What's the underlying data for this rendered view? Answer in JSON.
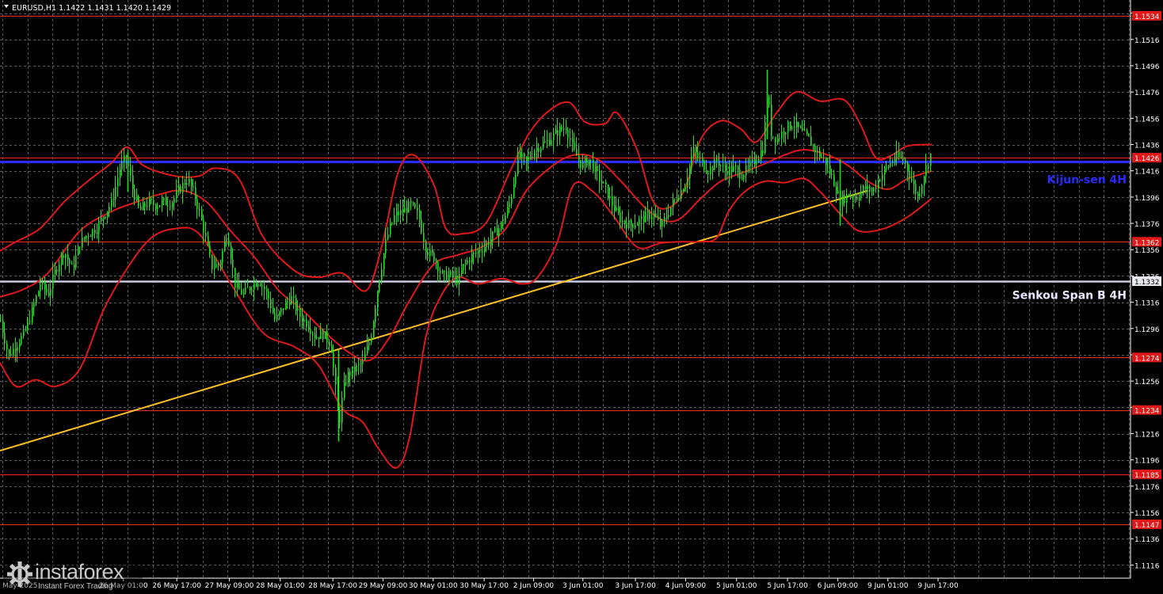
{
  "header": {
    "menu_arrow": "triangle-down-icon",
    "title": "EURUSD,H1  1.1422 1.1431 1.1420 1.1429"
  },
  "logo": {
    "name": "instaforex",
    "tagline": "Instant Forex Trading",
    "icon": "gear-icon"
  },
  "chart_data": {
    "type": "candlestick",
    "symbol": "EURUSD",
    "timeframe": "H1",
    "last_bar": {
      "open": 1.1422,
      "high": 1.1431,
      "low": 1.142,
      "close": 1.1429
    },
    "ylim": [
      1.1106,
      1.1546
    ],
    "y_ticks": [
      "1.1536",
      "1.1516",
      "1.1496",
      "1.1476",
      "1.1456",
      "1.1436",
      "1.1416",
      "1.1396",
      "1.1376",
      "1.1356",
      "1.1336",
      "1.1316",
      "1.1296",
      "1.1276",
      "1.1256",
      "1.1236",
      "1.1216",
      "1.1196",
      "1.1176",
      "1.1156",
      "1.1136",
      "1.1116"
    ],
    "y_tick_values": [
      1.1536,
      1.1516,
      1.1496,
      1.1476,
      1.1456,
      1.1436,
      1.1416,
      1.1396,
      1.1376,
      1.1356,
      1.1336,
      1.1316,
      1.1296,
      1.1276,
      1.1256,
      1.1236,
      1.1216,
      1.1196,
      1.1176,
      1.1156,
      1.1136,
      1.1116
    ],
    "x_range": [
      0,
      1170
    ],
    "x_ticks": [
      {
        "label": "23 May 2025",
        "x": 18
      },
      {
        "label": "26 May 01:00",
        "x": 155
      },
      {
        "label": "26 May 17:00",
        "x": 222
      },
      {
        "label": "27 May 09:00",
        "x": 288
      },
      {
        "label": "28 May 01:00",
        "x": 352
      },
      {
        "label": "28 May 17:00",
        "x": 418
      },
      {
        "label": "29 May 09:00",
        "x": 481
      },
      {
        "label": "30 May 01:00",
        "x": 544
      },
      {
        "label": "30 May 17:00",
        "x": 608
      },
      {
        "label": "2 Jun 09:00",
        "x": 670
      },
      {
        "label": "3 Jun 01:00",
        "x": 732
      },
      {
        "label": "3 Jun 17:00",
        "x": 798
      },
      {
        "label": "4 Jun 09:00",
        "x": 861
      },
      {
        "label": "5 Jun 01:00",
        "x": 925
      },
      {
        "label": "5 Jun 17:00",
        "x": 989
      },
      {
        "label": "6 Jun 09:00",
        "x": 1052
      },
      {
        "label": "9 Jun 01:00",
        "x": 1115
      },
      {
        "label": "9 Jun 17:00",
        "x": 1178
      }
    ],
    "grid": true,
    "horizontal_levels": [
      {
        "value": 1.1534,
        "label": "1.1534",
        "color": "#ff2020"
      },
      {
        "value": 1.1426,
        "label": "1.1426",
        "color": "#ff2020"
      },
      {
        "value": 1.1423,
        "label": "",
        "color": "#2a2aff",
        "text": "Kijun-sen 4H",
        "text_color": "#2a2aff"
      },
      {
        "value": 1.1362,
        "label": "1.1362",
        "color": "#ff2020"
      },
      {
        "value": 1.1332,
        "label": "1.1332",
        "color": "#c8c8e0",
        "text": "Senkou Span B 4H",
        "text_color": "#e8e8ff"
      },
      {
        "value": 1.1274,
        "label": "1.1274",
        "color": "#ff2020"
      },
      {
        "value": 1.1234,
        "label": "1.1234",
        "color": "#ff2020"
      },
      {
        "value": 1.1185,
        "label": "1.1185",
        "color": "#ff2020"
      },
      {
        "value": 1.1147,
        "label": "1.1147",
        "color": "#ff2020"
      }
    ],
    "trendline": {
      "color": "#ffc020",
      "points": [
        [
          0,
          1.1203
        ],
        [
          1090,
          1.1401
        ]
      ]
    },
    "price_path": [
      [
        0,
        1.1302
      ],
      [
        10,
        1.1275
      ],
      [
        20,
        1.1284
      ],
      [
        30,
        1.1292
      ],
      [
        40,
        1.131
      ],
      [
        50,
        1.133
      ],
      [
        60,
        1.1322
      ],
      [
        70,
        1.1342
      ],
      [
        80,
        1.1355
      ],
      [
        90,
        1.1341
      ],
      [
        100,
        1.1361
      ],
      [
        110,
        1.1368
      ],
      [
        120,
        1.1372
      ],
      [
        130,
        1.1383
      ],
      [
        140,
        1.1392
      ],
      [
        150,
        1.1418
      ],
      [
        158,
        1.1427
      ],
      [
        165,
        1.1404
      ],
      [
        175,
        1.1385
      ],
      [
        185,
        1.1392
      ],
      [
        195,
        1.139
      ],
      [
        205,
        1.1392
      ],
      [
        215,
        1.1392
      ],
      [
        225,
        1.1402
      ],
      [
        235,
        1.141
      ],
      [
        245,
        1.1395
      ],
      [
        255,
        1.1372
      ],
      [
        265,
        1.1343
      ],
      [
        275,
        1.1345
      ],
      [
        285,
        1.137
      ],
      [
        295,
        1.1328
      ],
      [
        305,
        1.1322
      ],
      [
        315,
        1.1329
      ],
      [
        325,
        1.1333
      ],
      [
        335,
        1.1322
      ],
      [
        345,
        1.1302
      ],
      [
        355,
        1.1312
      ],
      [
        365,
        1.132
      ],
      [
        375,
        1.1306
      ],
      [
        385,
        1.13
      ],
      [
        395,
        1.129
      ],
      [
        405,
        1.1292
      ],
      [
        415,
        1.1284
      ],
      [
        420,
        1.1255
      ],
      [
        425,
        1.1222
      ],
      [
        430,
        1.1248
      ],
      [
        435,
        1.126
      ],
      [
        445,
        1.1265
      ],
      [
        455,
        1.127
      ],
      [
        465,
        1.129
      ],
      [
        475,
        1.1332
      ],
      [
        485,
        1.1365
      ],
      [
        495,
        1.1382
      ],
      [
        505,
        1.1385
      ],
      [
        515,
        1.139
      ],
      [
        525,
        1.1382
      ],
      [
        535,
        1.1355
      ],
      [
        545,
        1.135
      ],
      [
        555,
        1.1336
      ],
      [
        565,
        1.1336
      ],
      [
        575,
        1.1332
      ],
      [
        580,
        1.1342
      ],
      [
        590,
        1.135
      ],
      [
        600,
        1.1355
      ],
      [
        610,
        1.136
      ],
      [
        620,
        1.1368
      ],
      [
        630,
        1.1376
      ],
      [
        640,
        1.1392
      ],
      [
        650,
        1.1428
      ],
      [
        660,
        1.1422
      ],
      [
        670,
        1.1432
      ],
      [
        680,
        1.1436
      ],
      [
        690,
        1.144
      ],
      [
        700,
        1.1446
      ],
      [
        710,
        1.145
      ],
      [
        720,
        1.1431
      ],
      [
        730,
        1.142
      ],
      [
        740,
        1.1425
      ],
      [
        750,
        1.1412
      ],
      [
        760,
        1.1402
      ],
      [
        770,
        1.1388
      ],
      [
        780,
        1.1378
      ],
      [
        790,
        1.1375
      ],
      [
        800,
        1.1377
      ],
      [
        810,
        1.1381
      ],
      [
        820,
        1.1383
      ],
      [
        830,
        1.1373
      ],
      [
        840,
        1.1387
      ],
      [
        850,
        1.1397
      ],
      [
        860,
        1.1406
      ],
      [
        870,
        1.1432
      ],
      [
        880,
        1.1422
      ],
      [
        890,
        1.1416
      ],
      [
        900,
        1.1424
      ],
      [
        910,
        1.1416
      ],
      [
        920,
        1.1418
      ],
      [
        930,
        1.1413
      ],
      [
        940,
        1.1418
      ],
      [
        950,
        1.1426
      ],
      [
        958,
        1.1434
      ],
      [
        963,
        1.1478
      ],
      [
        968,
        1.1444
      ],
      [
        975,
        1.144
      ],
      [
        985,
        1.1448
      ],
      [
        995,
        1.1452
      ],
      [
        1005,
        1.1446
      ],
      [
        1015,
        1.144
      ],
      [
        1025,
        1.143
      ],
      [
        1035,
        1.1424
      ],
      [
        1045,
        1.141
      ],
      [
        1055,
        1.1393
      ],
      [
        1065,
        1.1398
      ],
      [
        1075,
        1.1396
      ],
      [
        1085,
        1.1403
      ],
      [
        1095,
        1.14
      ],
      [
        1105,
        1.1412
      ],
      [
        1115,
        1.142
      ],
      [
        1125,
        1.1427
      ],
      [
        1135,
        1.1424
      ],
      [
        1145,
        1.1407
      ],
      [
        1152,
        1.1396
      ],
      [
        1160,
        1.1414
      ],
      [
        1168,
        1.1429
      ]
    ],
    "bollinger_upper": [
      [
        0,
        1.1355
      ],
      [
        20,
        1.1362
      ],
      [
        50,
        1.1372
      ],
      [
        80,
        1.1392
      ],
      [
        110,
        1.1408
      ],
      [
        140,
        1.1422
      ],
      [
        160,
        1.1434
      ],
      [
        180,
        1.142
      ],
      [
        220,
        1.1412
      ],
      [
        250,
        1.1412
      ],
      [
        270,
        1.1418
      ],
      [
        300,
        1.141
      ],
      [
        330,
        1.1366
      ],
      [
        370,
        1.134
      ],
      [
        400,
        1.1335
      ],
      [
        430,
        1.1338
      ],
      [
        460,
        1.1325
      ],
      [
        480,
        1.136
      ],
      [
        500,
        1.1415
      ],
      [
        520,
        1.1428
      ],
      [
        545,
        1.1405
      ],
      [
        560,
        1.1372
      ],
      [
        580,
        1.1368
      ],
      [
        610,
        1.1376
      ],
      [
        640,
        1.1415
      ],
      [
        665,
        1.1445
      ],
      [
        690,
        1.1462
      ],
      [
        715,
        1.1468
      ],
      [
        735,
        1.1453
      ],
      [
        760,
        1.1452
      ],
      [
        775,
        1.146
      ],
      [
        800,
        1.1432
      ],
      [
        820,
        1.1393
      ],
      [
        840,
        1.1388
      ],
      [
        860,
        1.1402
      ],
      [
        880,
        1.144
      ],
      [
        905,
        1.1454
      ],
      [
        930,
        1.1448
      ],
      [
        950,
        1.1438
      ],
      [
        975,
        1.146
      ],
      [
        1000,
        1.1476
      ],
      [
        1030,
        1.1469
      ],
      [
        1060,
        1.147
      ],
      [
        1080,
        1.1452
      ],
      [
        1100,
        1.1426
      ],
      [
        1120,
        1.1428
      ],
      [
        1140,
        1.1435
      ],
      [
        1170,
        1.1436
      ]
    ],
    "bollinger_middle": [
      [
        0,
        1.132
      ],
      [
        30,
        1.1326
      ],
      [
        60,
        1.1338
      ],
      [
        100,
        1.137
      ],
      [
        140,
        1.1385
      ],
      [
        170,
        1.1392
      ],
      [
        200,
        1.1398
      ],
      [
        230,
        1.1401
      ],
      [
        260,
        1.1392
      ],
      [
        290,
        1.137
      ],
      [
        320,
        1.135
      ],
      [
        350,
        1.1325
      ],
      [
        380,
        1.131
      ],
      [
        410,
        1.1292
      ],
      [
        440,
        1.1277
      ],
      [
        465,
        1.1272
      ],
      [
        490,
        1.129
      ],
      [
        515,
        1.1318
      ],
      [
        545,
        1.1345
      ],
      [
        575,
        1.1352
      ],
      [
        605,
        1.1358
      ],
      [
        635,
        1.1372
      ],
      [
        660,
        1.14
      ],
      [
        690,
        1.1418
      ],
      [
        720,
        1.1428
      ],
      [
        750,
        1.1425
      ],
      [
        780,
        1.1408
      ],
      [
        810,
        1.1388
      ],
      [
        835,
        1.1378
      ],
      [
        855,
        1.138
      ],
      [
        880,
        1.1395
      ],
      [
        905,
        1.1408
      ],
      [
        930,
        1.1414
      ],
      [
        955,
        1.142
      ],
      [
        985,
        1.1428
      ],
      [
        1010,
        1.1432
      ],
      [
        1040,
        1.1428
      ],
      [
        1065,
        1.142
      ],
      [
        1090,
        1.1408
      ],
      [
        1115,
        1.1402
      ],
      [
        1140,
        1.141
      ],
      [
        1170,
        1.1416
      ]
    ],
    "bollinger_lower": [
      [
        0,
        1.127
      ],
      [
        20,
        1.1252
      ],
      [
        45,
        1.1257
      ],
      [
        70,
        1.1252
      ],
      [
        100,
        1.1265
      ],
      [
        130,
        1.131
      ],
      [
        160,
        1.1342
      ],
      [
        190,
        1.1365
      ],
      [
        220,
        1.1372
      ],
      [
        250,
        1.1368
      ],
      [
        290,
        1.133
      ],
      [
        330,
        1.1293
      ],
      [
        370,
        1.1282
      ],
      [
        400,
        1.1268
      ],
      [
        430,
        1.1235
      ],
      [
        455,
        1.1225
      ],
      [
        475,
        1.1205
      ],
      [
        498,
        1.119
      ],
      [
        515,
        1.1215
      ],
      [
        535,
        1.129
      ],
      [
        555,
        1.1322
      ],
      [
        575,
        1.1335
      ],
      [
        600,
        1.133
      ],
      [
        630,
        1.1334
      ],
      [
        655,
        1.133
      ],
      [
        675,
        1.1335
      ],
      [
        700,
        1.1362
      ],
      [
        720,
        1.1405
      ],
      [
        745,
        1.14
      ],
      [
        770,
        1.1382
      ],
      [
        800,
        1.1358
      ],
      [
        830,
        1.1361
      ],
      [
        855,
        1.1362
      ],
      [
        880,
        1.1362
      ],
      [
        900,
        1.1365
      ],
      [
        915,
        1.1385
      ],
      [
        935,
        1.14
      ],
      [
        960,
        1.1408
      ],
      [
        985,
        1.1407
      ],
      [
        1010,
        1.141
      ],
      [
        1030,
        1.14
      ],
      [
        1060,
        1.138
      ],
      [
        1080,
        1.137
      ],
      [
        1110,
        1.1372
      ],
      [
        1140,
        1.1381
      ],
      [
        1170,
        1.1395
      ]
    ],
    "spikes": [
      {
        "x": 963,
        "high": 1.1493,
        "low": 1.144
      },
      {
        "x": 425,
        "high": 1.128,
        "low": 1.121
      },
      {
        "x": 1055,
        "high": 1.1425,
        "low": 1.1374
      },
      {
        "x": 160,
        "high": 1.143,
        "low": 1.14
      }
    ],
    "colors": {
      "background": "#000000",
      "grid": "#5a5a5a",
      "candles": "#20e020",
      "bands": "#e01818",
      "axis": "#ffffff",
      "tick_text": "#ffffff",
      "price_label_bg": "#e01818",
      "price_label_text": "#ffffff"
    }
  }
}
